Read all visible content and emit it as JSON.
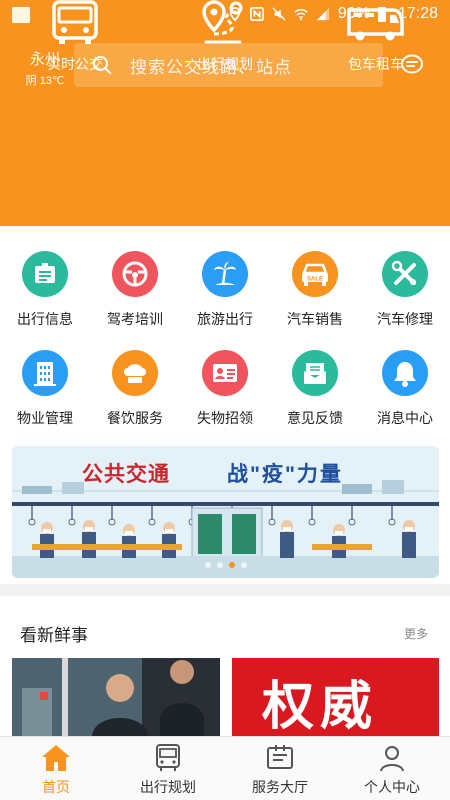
{
  "status_bar": {
    "battery": "90%",
    "time": "17:28"
  },
  "header": {
    "city": "永州",
    "weather": "阴 13℃",
    "search_placeholder": "搜索公交线路、站点"
  },
  "top_nav": [
    {
      "label": "实时公交",
      "icon": "bus-icon"
    },
    {
      "label": "出行规划",
      "icon": "route-icon"
    },
    {
      "label": "包车租车",
      "icon": "coach-icon"
    }
  ],
  "services": [
    {
      "label": "出行信息",
      "icon": "info-board-icon",
      "color": "#2bbb9c"
    },
    {
      "label": "驾考培训",
      "icon": "steering-wheel-icon",
      "color": "#f0545c"
    },
    {
      "label": "旅游出行",
      "icon": "palm-tree-icon",
      "color": "#2a9df4"
    },
    {
      "label": "汽车销售",
      "icon": "car-sale-icon",
      "color": "#f7931e"
    },
    {
      "label": "汽车修理",
      "icon": "wrench-icon",
      "color": "#2bbb9c"
    },
    {
      "label": "物业管理",
      "icon": "building-icon",
      "color": "#2a9df4"
    },
    {
      "label": "餐饮服务",
      "icon": "chef-hat-icon",
      "color": "#f7931e"
    },
    {
      "label": "失物招领",
      "icon": "id-card-icon",
      "color": "#f0545c"
    },
    {
      "label": "意见反馈",
      "icon": "mail-icon",
      "color": "#2bbb9c"
    },
    {
      "label": "消息中心",
      "icon": "bell-icon",
      "color": "#2a9df4"
    }
  ],
  "banner": {
    "title_left": "公共交通",
    "title_right": "战\"疫\"力量"
  },
  "news": {
    "title": "看新鲜事",
    "more": "更多",
    "card2_text": "权威"
  },
  "bottom_nav": [
    {
      "label": "首页",
      "icon": "home-icon",
      "active": true
    },
    {
      "label": "出行规划",
      "icon": "bus-front-icon",
      "active": false
    },
    {
      "label": "服务大厅",
      "icon": "service-hall-icon",
      "active": false
    },
    {
      "label": "个人中心",
      "icon": "person-icon",
      "active": false
    }
  ],
  "colors": {
    "brand": "#f7931e",
    "teal": "#2bbb9c",
    "red": "#f0545c",
    "blue": "#2a9df4"
  }
}
